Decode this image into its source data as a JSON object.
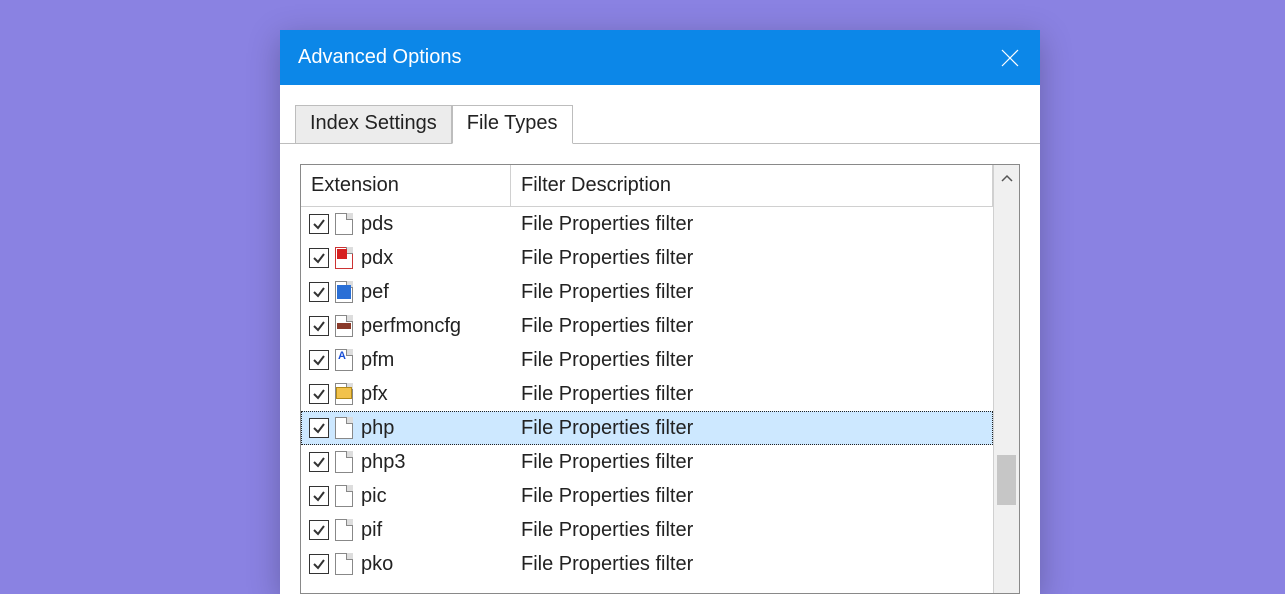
{
  "window": {
    "title": "Advanced Options"
  },
  "tabs": [
    {
      "label": "Index Settings",
      "active": false
    },
    {
      "label": "File Types",
      "active": true
    }
  ],
  "columns": {
    "extension": "Extension",
    "description": "Filter Description"
  },
  "rows": [
    {
      "ext": "pds",
      "desc": "File Properties filter",
      "icon": "generic",
      "checked": true,
      "selected": false
    },
    {
      "ext": "pdx",
      "desc": "File Properties filter",
      "icon": "pdf",
      "checked": true,
      "selected": false
    },
    {
      "ext": "pef",
      "desc": "File Properties filter",
      "icon": "img",
      "checked": true,
      "selected": false
    },
    {
      "ext": "perfmoncfg",
      "desc": "File Properties filter",
      "icon": "folder",
      "checked": true,
      "selected": false
    },
    {
      "ext": "pfm",
      "desc": "File Properties filter",
      "icon": "font",
      "checked": true,
      "selected": false
    },
    {
      "ext": "pfx",
      "desc": "File Properties filter",
      "icon": "cert",
      "checked": true,
      "selected": false
    },
    {
      "ext": "php",
      "desc": "File Properties filter",
      "icon": "generic",
      "checked": true,
      "selected": true
    },
    {
      "ext": "php3",
      "desc": "File Properties filter",
      "icon": "generic",
      "checked": true,
      "selected": false
    },
    {
      "ext": "pic",
      "desc": "File Properties filter",
      "icon": "generic",
      "checked": true,
      "selected": false
    },
    {
      "ext": "pif",
      "desc": "File Properties filter",
      "icon": "generic",
      "checked": true,
      "selected": false
    },
    {
      "ext": "pko",
      "desc": "File Properties filter",
      "icon": "generic",
      "checked": true,
      "selected": false
    }
  ]
}
